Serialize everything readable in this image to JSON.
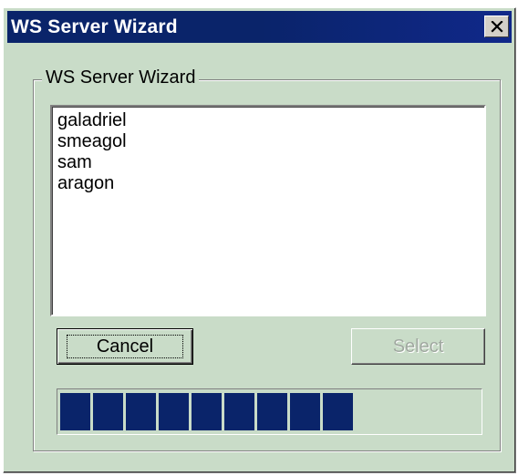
{
  "window": {
    "title": "WS Server Wizard",
    "close_label": "×"
  },
  "group": {
    "label": "WS Server Wizard"
  },
  "list": {
    "items": [
      "galadriel",
      "smeagol",
      "sam",
      "aragon"
    ]
  },
  "buttons": {
    "cancel": "Cancel",
    "select": "Select"
  },
  "progress": {
    "value": 0.7,
    "color": "#0a246a"
  },
  "colors": {
    "face": "#c9dcc8",
    "titlebar": "#0a246a",
    "disabled_text": "#a0a8a0"
  },
  "icons": {
    "close": "close-icon"
  }
}
